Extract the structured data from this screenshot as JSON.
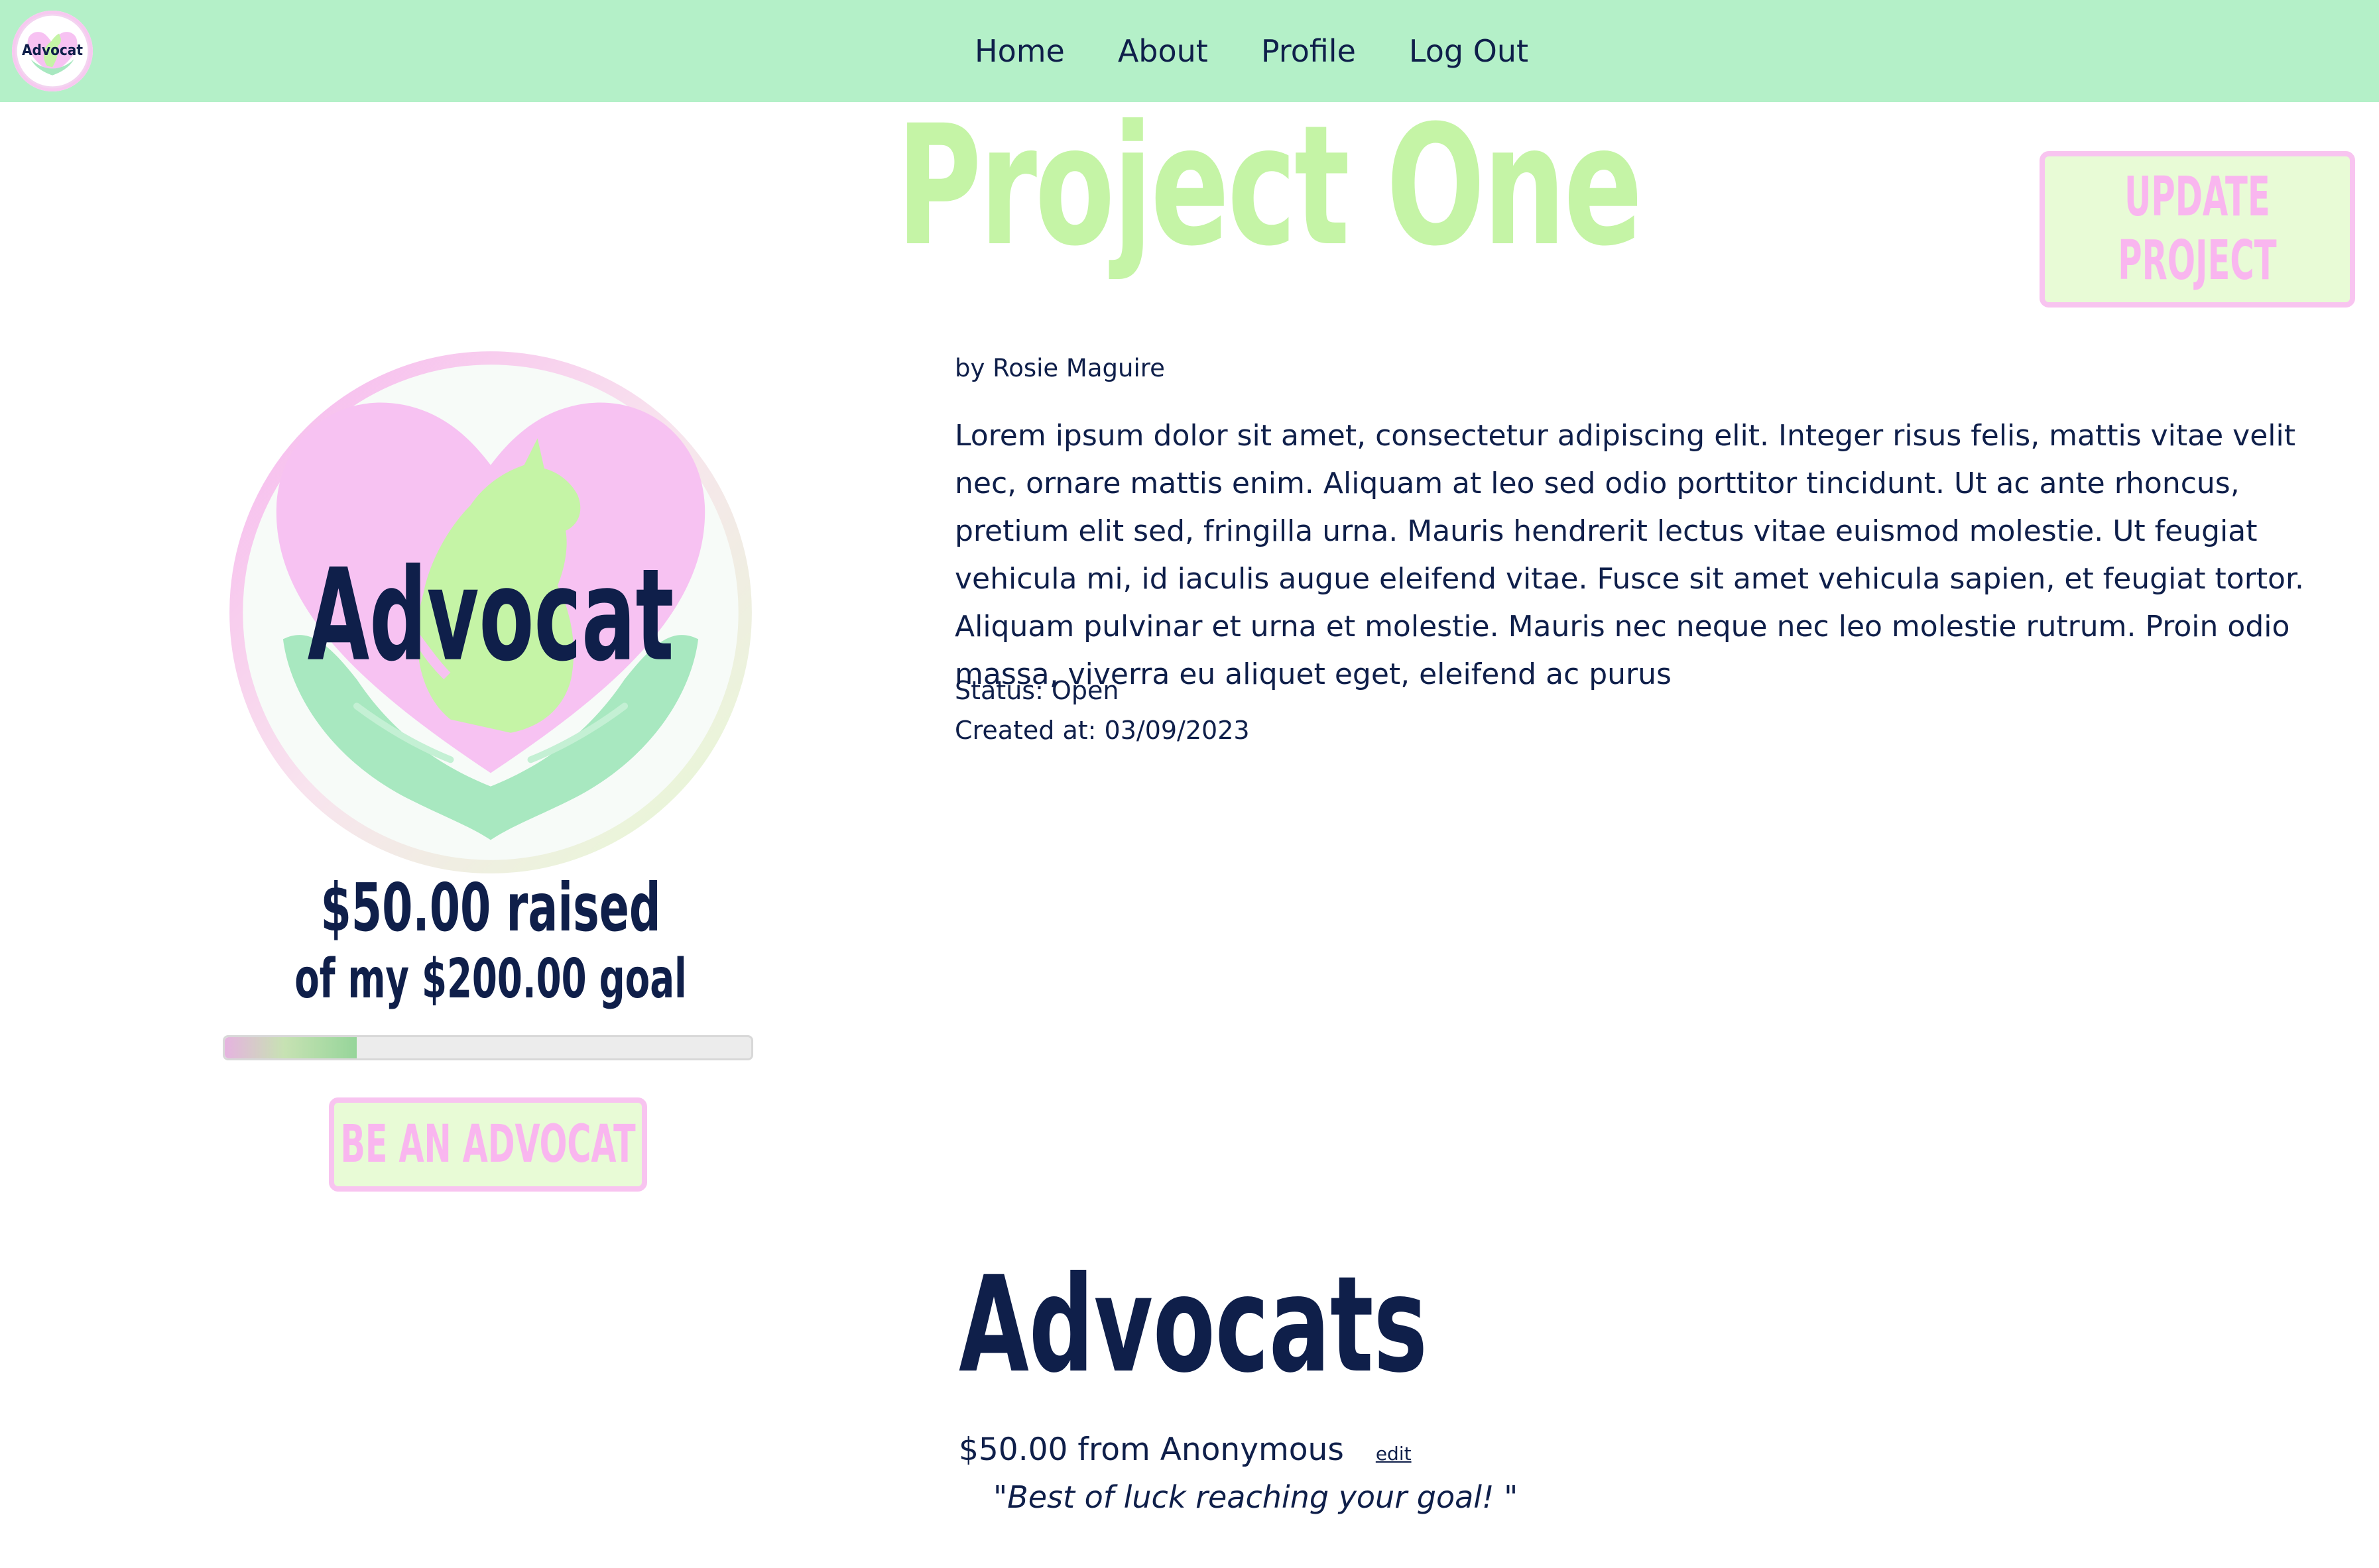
{
  "nav": {
    "logo_text": "Advocat",
    "links": [
      "Home",
      "About",
      "Profile",
      "Log Out"
    ]
  },
  "project": {
    "title": "Project One",
    "update_button": [
      "UPDATE",
      "PROJECT"
    ],
    "author": "by Rosie Maguire",
    "description": "Lorem ipsum dolor sit amet, consectetur adipiscing elit. Integer risus felis, mattis vitae velit nec, ornare mattis enim. Aliquam at leo sed odio porttitor tincidunt. Ut ac ante rhoncus, pretium elit sed, fringilla urna. Mauris hendrerit lectus vitae euismod molestie. Ut feugiat vehicula mi, id iaculis augue eleifend vitae. Fusce sit amet vehicula sapien, et feugiat tortor. Aliquam pulvinar et urna et molestie. Mauris nec neque nec leo molestie rutrum. Proin odio massa, viverra eu aliquet eget, eleifend ac purus",
    "status": "Status: Open",
    "created_at": "Created at: 03/09/2023"
  },
  "hero": {
    "logo_text": "Advocat",
    "raised": "$50.00 raised",
    "goal": "of my $200.00 goal",
    "progress_fraction": 0.25,
    "cta": "BE AN ADVOCAT"
  },
  "advocates": {
    "heading": "Advocats",
    "pledges": [
      {
        "summary": "$50.00 from Anonymous",
        "edit_label": "edit",
        "comment": "\"Best of luck reaching your goal! \""
      }
    ]
  },
  "colors": {
    "nav_bg": "#b4f0c8",
    "title_green": "#c5f4a6",
    "navy": "#0f1f4a",
    "pink": "#f9b6ef",
    "button_bg": "#e8fbd6"
  }
}
